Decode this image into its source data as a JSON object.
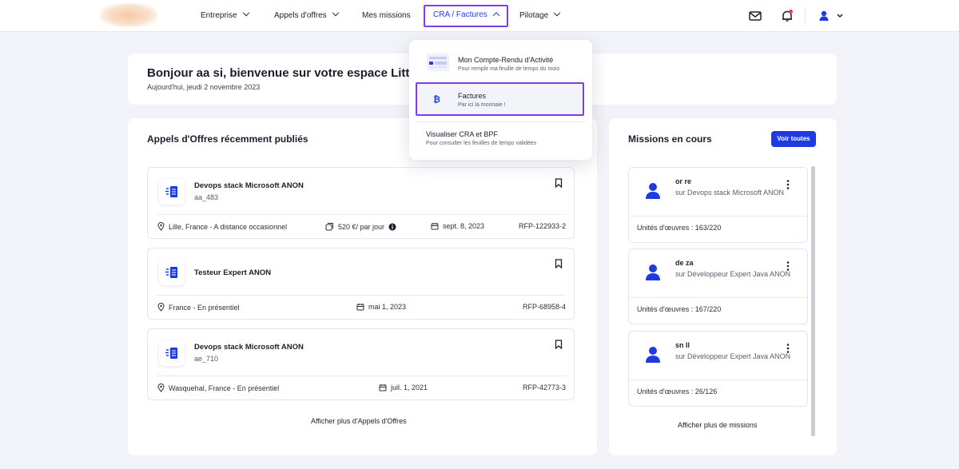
{
  "nav": {
    "items": [
      {
        "label": "Entreprise",
        "has_chevron": true
      },
      {
        "label": "Appels d'offres",
        "has_chevron": true
      },
      {
        "label": "Mes missions",
        "has_chevron": false
      },
      {
        "label": "CRA / Factures",
        "has_chevron": true,
        "active": true
      },
      {
        "label": "Pilotage",
        "has_chevron": true
      }
    ],
    "icons": [
      "mail-icon",
      "bell-icon",
      "user-icon",
      "chevron-down-icon"
    ],
    "accent_color": "#2640e0",
    "highlight_color": "#7b3fe4",
    "notification_dot_color": "#e5394a"
  },
  "dropdown": {
    "items": [
      {
        "title": "Mon Compte-Rendu d'Activité",
        "subtitle": "Pour remplir ma feuille de temps du mois",
        "icon": "timesheet-icon"
      },
      {
        "title": "Factures",
        "subtitle": "Par ici la monnaie !",
        "icon": "bitcoin-icon",
        "highlighted": true
      },
      {
        "title": "Visualiser CRA et BPF",
        "subtitle": "Pour consulter les feuilles de temps validées"
      }
    ]
  },
  "welcome": {
    "title": "Bonjour aa si, bienvenue sur votre espace Little",
    "date": "Aujourd'hui, jeudi 2 novembre 2023"
  },
  "offers": {
    "title": "Appels d'Offres récemment publiés",
    "items": [
      {
        "title": "Devops stack Microsoft ANON",
        "subtitle": "aa_483",
        "location": "Lille, France - A distance occasionnel",
        "rate": "520 €/ par jour",
        "date": "sept. 8, 2023",
        "ref": "RFP-122933-2"
      },
      {
        "title": "Testeur Expert ANON",
        "subtitle": "",
        "location": "France - En présentiel",
        "rate": "",
        "date": "mai 1, 2023",
        "ref": "RFP-68958-4"
      },
      {
        "title": "Devops stack Microsoft ANON",
        "subtitle": "ae_710",
        "location": "Wasquehal, France - En présentiel",
        "rate": "",
        "date": "juil. 1, 2021",
        "ref": "RFP-42773-3"
      }
    ],
    "more": "Afficher plus d'Appels d'Offres"
  },
  "missions": {
    "title": "Missions en cours",
    "see_all": "Voir toutes",
    "items": [
      {
        "name": "or re",
        "subtitle": "sur Devops stack Microsoft ANON",
        "units": "Unités d'œuvres : 163/220"
      },
      {
        "name": "de za",
        "subtitle": "sur Développeur Expert Java ANON",
        "units": "Unités d'œuvres : 167/220"
      },
      {
        "name": "sn ll",
        "subtitle": "sur Développeur Expert Java ANON",
        "units": "Unités d'œuvres : 26/126"
      }
    ],
    "more": "Afficher plus de missions"
  }
}
